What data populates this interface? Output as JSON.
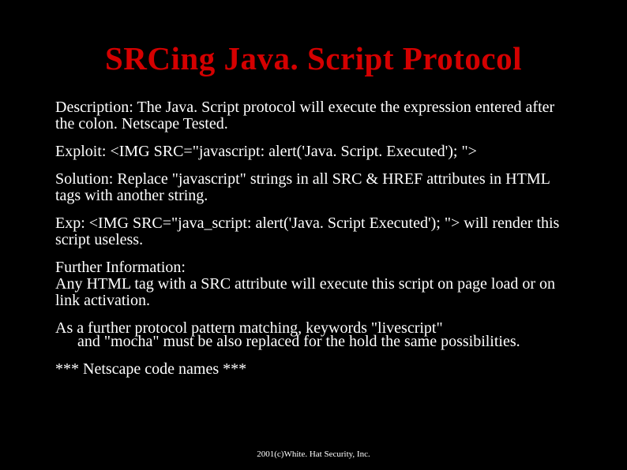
{
  "title": "SRCing Java. Script Protocol",
  "paragraphs": [
    {
      "text": "Description: The Java. Script protocol will execute the expression entered after the colon. Netscape Tested.",
      "indent": false
    },
    {
      "text": "Exploit: <IMG SRC=\"javascript: alert('Java. Script. Executed'); \">",
      "indent": false
    },
    {
      "text": "Solution: Replace \"javascript\" strings in all SRC & HREF attributes in HTML tags with another string.",
      "indent": false
    },
    {
      "text": "Exp: <IMG SRC=\"java_script: alert('Java. Script Executed'); \"> will render this script useless.",
      "indent": false
    },
    {
      "text": "Further Information:\nAny HTML tag with a SRC attribute will execute this script on page load or on link activation.",
      "indent": false
    },
    {
      "text": "As a further protocol pattern matching, keywords \"livescript\"",
      "indent": false
    },
    {
      "text": "and \"mocha\" must be also replaced for the hold the same possibilities.",
      "indent": true
    },
    {
      "text": "*** Netscape code names ***",
      "indent": false
    }
  ],
  "footer": "2001(c)White. Hat Security, Inc."
}
